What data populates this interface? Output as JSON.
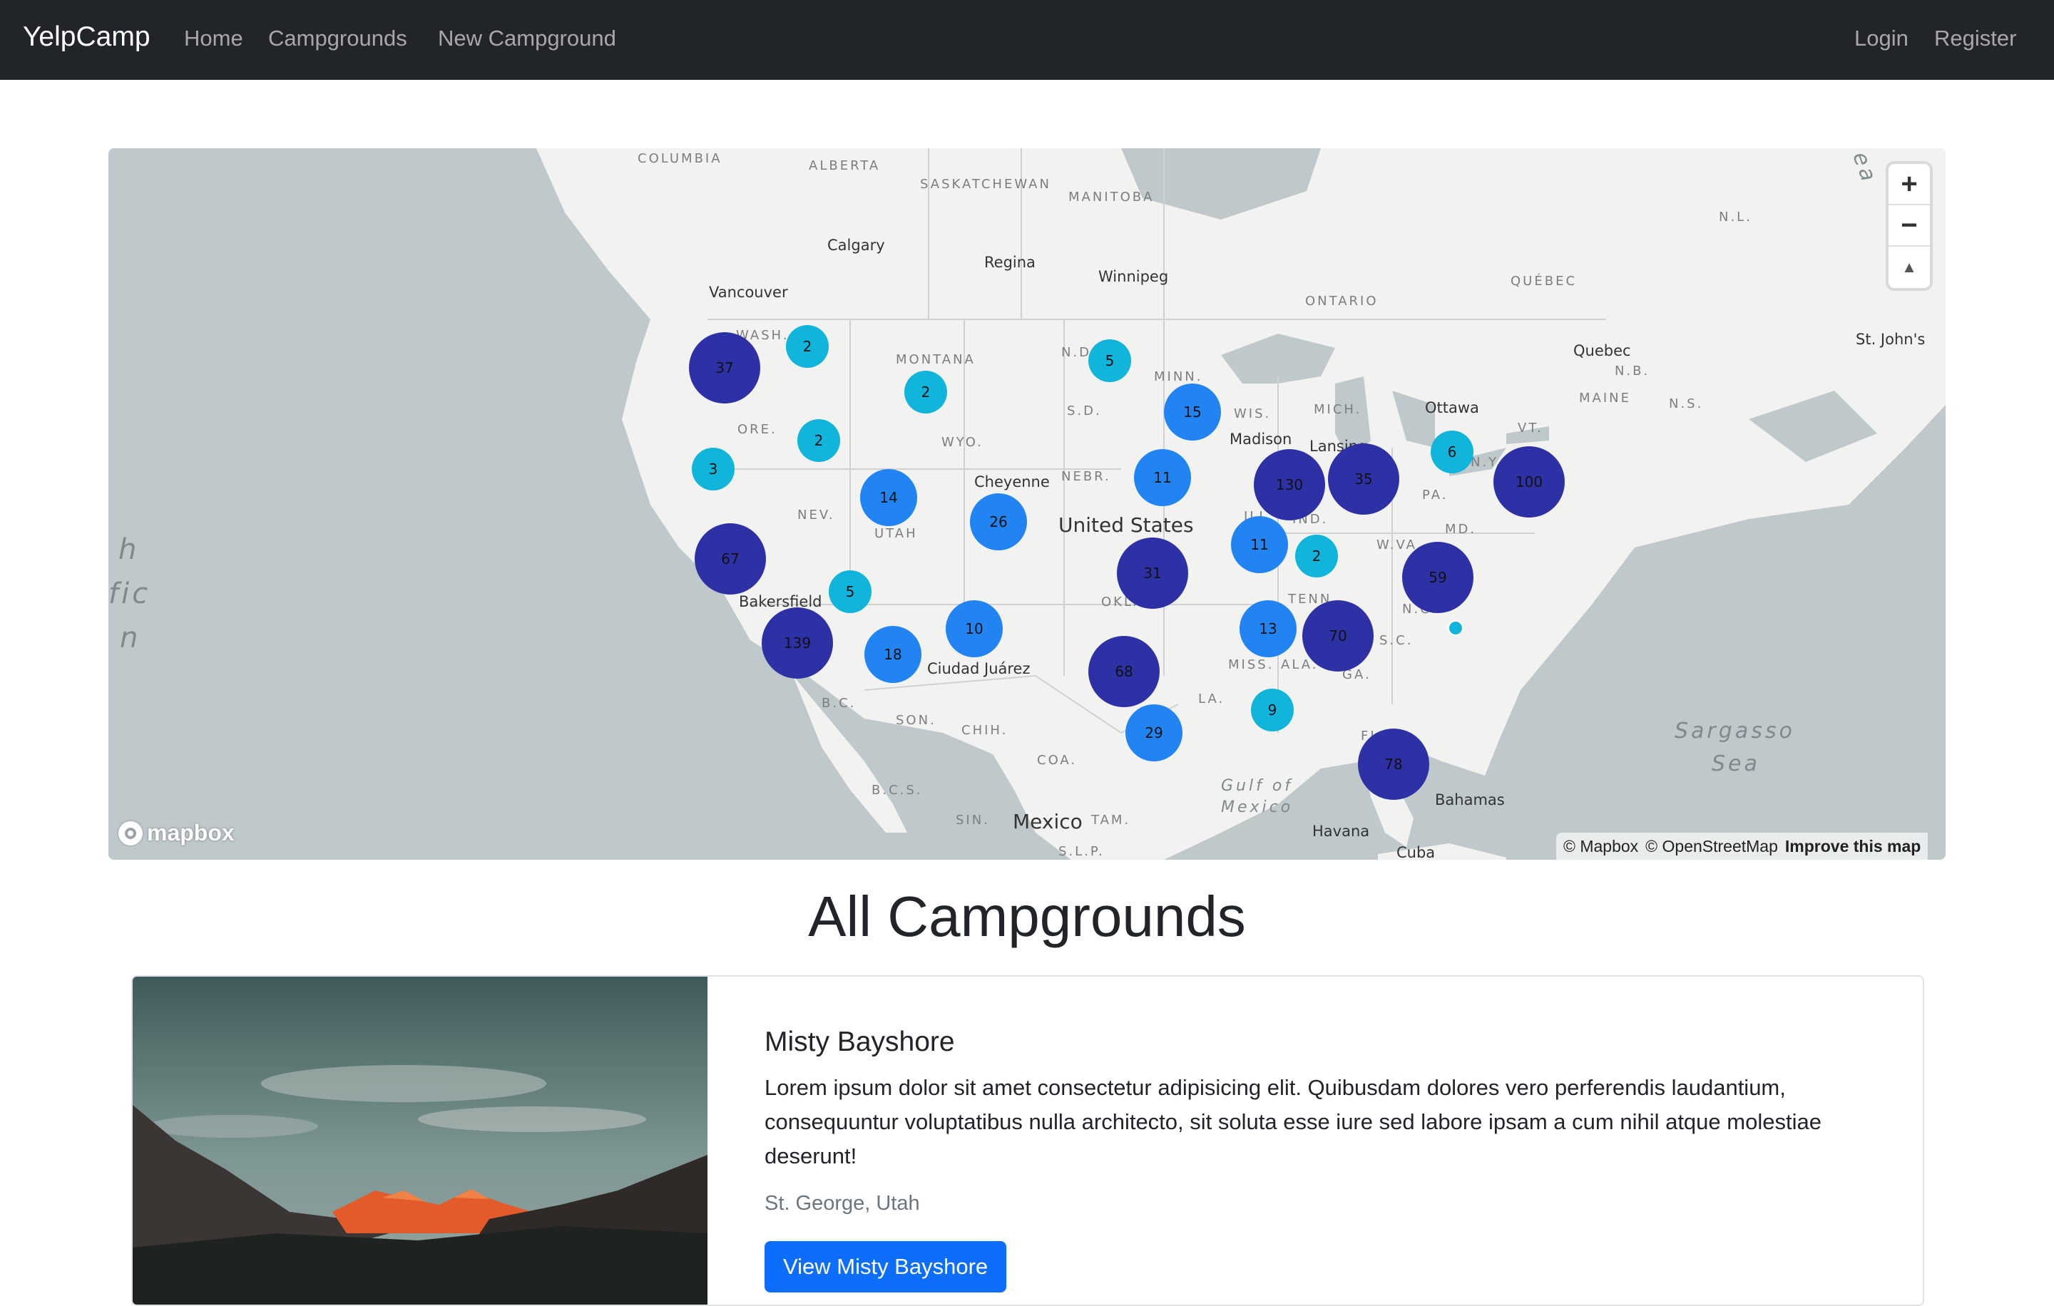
{
  "navbar": {
    "brand": "YelpCamp",
    "links": [
      "Home",
      "Campgrounds",
      "New Campground"
    ],
    "right_links": [
      "Login",
      "Register"
    ]
  },
  "map": {
    "controls": {
      "zoom_in": "+",
      "zoom_out": "−",
      "compass": "▲"
    },
    "logo": "mapbox",
    "attribution": {
      "mapbox": "© Mapbox",
      "osm": "© OpenStreetMap",
      "improve": "Improve this map"
    },
    "clusters": [
      "37",
      "2",
      "2",
      "5",
      "15",
      "2",
      "3",
      "14",
      "26",
      "11",
      "130",
      "35",
      "6",
      "100",
      "67",
      "5",
      "11",
      "2",
      "31",
      "59",
      "139",
      "18",
      "10",
      "13",
      "70",
      "68",
      "9",
      "29",
      "78"
    ],
    "labels": {
      "states": [
        "COLUMBIA",
        "ALBERTA",
        "SASKATCHEWAN",
        "MANITOBA",
        "ONTARIO",
        "QUÉBEC",
        "N.L.",
        "WASH.",
        "MONTANA",
        "N.D.",
        "MINN.",
        "MAINE",
        "N.B.",
        "N.S.",
        "ORE.",
        "WYO.",
        "S.D.",
        "WIS.",
        "MICH.",
        "VT.",
        "N.Y.",
        "NEBR.",
        "NEV.",
        "UTAH",
        "PA.",
        "IND.",
        "ILL.",
        "MD.",
        "W.VA.",
        "OKLA.",
        "TENN.",
        "N.C.",
        "S.C.",
        "MISS.",
        "ALA.",
        "GA.",
        "LA.",
        "FL.",
        "B.C.",
        "SON.",
        "CHIH.",
        "COA.",
        "B.C.S.",
        "SIN.",
        "TAM.",
        "S.L.P."
      ],
      "cities": [
        "Calgary",
        "Regina",
        "Winnipeg",
        "Vancouver",
        "Quebec",
        "St. John's",
        "Ottawa",
        "Madison",
        "Lansing",
        "Cheyenne",
        "Bakersfield",
        "Ciudad Juárez",
        "Bahamas",
        "Havana",
        "Cuba"
      ],
      "countries": [
        "United States",
        "Mexico"
      ],
      "water": [
        "Sargasso",
        "Sea",
        "Gulf of",
        "Mexico",
        "h",
        "fic",
        "n",
        "ea"
      ]
    }
  },
  "heading": "All Campgrounds",
  "campground": {
    "title": "Misty Bayshore",
    "description": "Lorem ipsum dolor sit amet consectetur adipisicing elit. Quibusdam dolores vero perferendis laudantium, consequuntur voluptatibus nulla architecto, sit soluta esse iure sed labore ipsam a cum nihil atque molestiae deserunt!",
    "location": "St. George, Utah",
    "button": "View Misty Bayshore"
  },
  "colors": {
    "navbar_bg": "#212529",
    "cluster_small": "#11b4da",
    "cluster_medium": "#2184f2",
    "cluster_large": "#2e31a6",
    "button_primary": "#0d6efd"
  }
}
